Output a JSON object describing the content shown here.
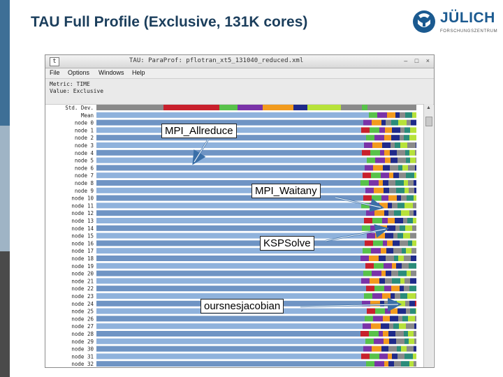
{
  "slide": {
    "title": "TAU Full Profile (Exclusive, 131K cores)",
    "logo_text": "JÜLICH",
    "logo_sub": "FORSCHUNGSZENTRUM"
  },
  "window": {
    "title": "TAU: ParaProf: pflotran_xt5_131040_reduced.xml",
    "menu": [
      "File",
      "Options",
      "Windows",
      "Help"
    ],
    "metric_line": "Metric: TIME",
    "value_line": "Value: Exclusive"
  },
  "colors": {
    "bar_blue": "#8fb2dc",
    "bar_blue_dark": "#6f94c4",
    "red": "#c8202c",
    "green": "#58c24a",
    "purple": "#7a33a8",
    "orange": "#f29b1e",
    "navy": "#1f2a8a",
    "yellow_green": "#b7e23a",
    "gray": "#8a8a8a",
    "teal": "#2a8c7a"
  },
  "callouts": [
    {
      "label": "MPI_Allreduce"
    },
    {
      "label": "MPI_Waitany"
    },
    {
      "label": "KSPSolve"
    },
    {
      "label": "oursnesjacobian"
    }
  ],
  "chart_data": {
    "type": "bar",
    "orientation": "horizontal-stacked",
    "row_labels": [
      "Std. Dev.",
      "Mean",
      "node 0",
      "node 1",
      "node 2",
      "node 3",
      "node 4",
      "node 5",
      "node 6",
      "node 7",
      "node 8",
      "node 9",
      "node 10",
      "node 11",
      "node 12",
      "node 13",
      "node 14",
      "node 15",
      "node 16",
      "node 17",
      "node 18",
      "node 19",
      "node 20",
      "node 21",
      "node 22",
      "node 23",
      "node 24",
      "node 25",
      "node 26",
      "node 27",
      "node 28",
      "node 29",
      "node 30",
      "node 31",
      "node 32"
    ]
  }
}
